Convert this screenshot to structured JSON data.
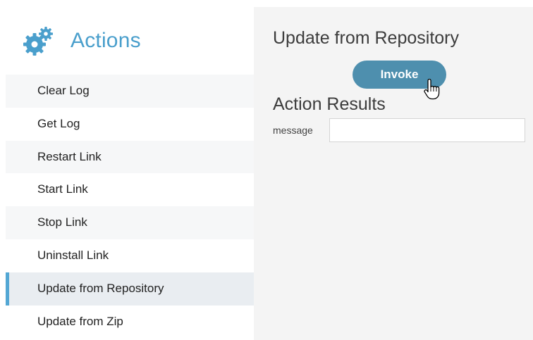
{
  "sidebar": {
    "title": "Actions",
    "icon": "gears-icon",
    "items": [
      {
        "label": "Clear Log"
      },
      {
        "label": "Get Log"
      },
      {
        "label": "Restart Link"
      },
      {
        "label": "Start Link"
      },
      {
        "label": "Stop Link"
      },
      {
        "label": "Uninstall Link"
      },
      {
        "label": "Update from Repository",
        "active": true
      },
      {
        "label": "Update from Zip"
      }
    ]
  },
  "main": {
    "title": "Update from Repository",
    "invoke_label": "Invoke",
    "results_title": "Action Results",
    "fields": [
      {
        "label": "message",
        "value": ""
      }
    ]
  },
  "colors": {
    "accent": "#4a9fcc",
    "button": "#4e8fae",
    "active_item_bg": "#e9edf1",
    "main_bg": "#f4f4f4"
  }
}
